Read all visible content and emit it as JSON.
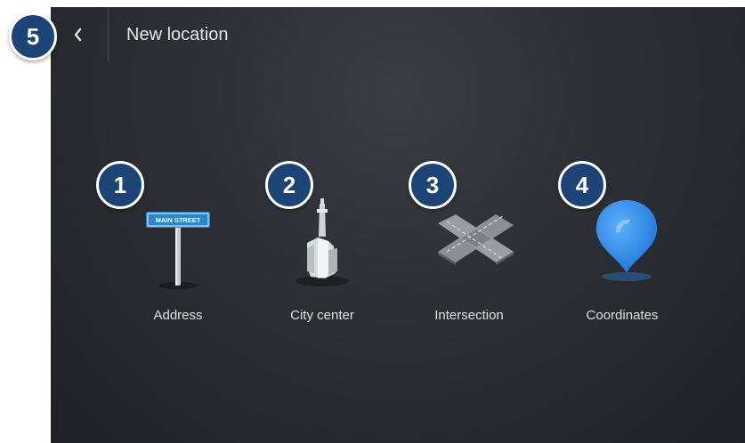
{
  "header": {
    "title": "New location",
    "back_icon": "chevron-left-icon"
  },
  "options": [
    {
      "label": "Address",
      "icon": "street-sign-icon",
      "sign_text": "MAIN STREET"
    },
    {
      "label": "City center",
      "icon": "city-skyline-icon"
    },
    {
      "label": "Intersection",
      "icon": "intersection-icon"
    },
    {
      "label": "Coordinates",
      "icon": "map-pin-icon"
    }
  ],
  "badges": [
    "1",
    "2",
    "3",
    "4",
    "5"
  ],
  "colors": {
    "badge": "#1d4477",
    "pin": "#2e8cf0",
    "text": "#e0e0e0"
  }
}
